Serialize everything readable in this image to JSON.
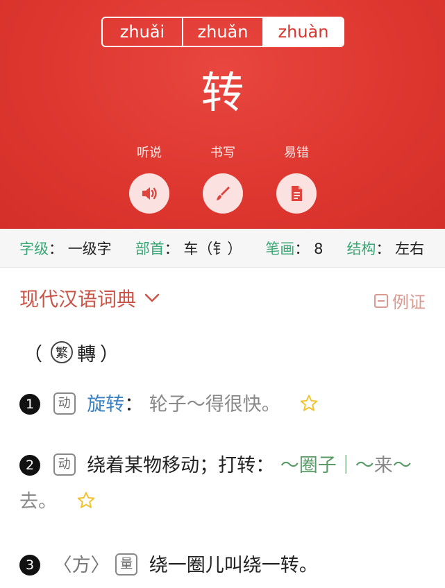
{
  "pinyin_tabs": [
    {
      "label": "zhuǎi",
      "active": false
    },
    {
      "label": "zhuǎn",
      "active": false
    },
    {
      "label": "zhuàn",
      "active": true
    }
  ],
  "character": "转",
  "actions": [
    {
      "label": "听说",
      "icon": "speaker-icon"
    },
    {
      "label": "书写",
      "icon": "brush-icon"
    },
    {
      "label": "易错",
      "icon": "document-icon"
    }
  ],
  "info": {
    "level_key": "字级",
    "level_val": "一级字",
    "radical_key": "部首",
    "radical_val": "车（钅）",
    "strokes_key": "笔画",
    "strokes_val": "8",
    "structure_key": "结构",
    "structure_val": "左右",
    "colon": "："
  },
  "dictionary": {
    "title": "现代汉语词典",
    "examples_label": "例证"
  },
  "traditional": {
    "open": "（",
    "badge": "繁",
    "char": "轉",
    "close": "）"
  },
  "definitions": [
    {
      "num": "1",
      "pos": "动",
      "term": "旋转",
      "colon": "：",
      "example": "轮子～得很快。"
    },
    {
      "num": "2",
      "pos": "动",
      "text": "绕着某物移动；打转：",
      "example": "～圈子｜～来～去。",
      "ex_a": "～圈子｜～",
      "ex_b": "来",
      "ex_c": "～",
      "ex_d": "去。"
    },
    {
      "num": "3",
      "region": "〈方〉",
      "pos": "量",
      "text": "绕一圈儿叫绕一转。"
    }
  ],
  "colors": {
    "header_red": "#de3730",
    "key_green": "#3aa876",
    "title_red": "#c95448",
    "link_blue": "#3b82c4",
    "star_yellow": "#f2c230"
  }
}
